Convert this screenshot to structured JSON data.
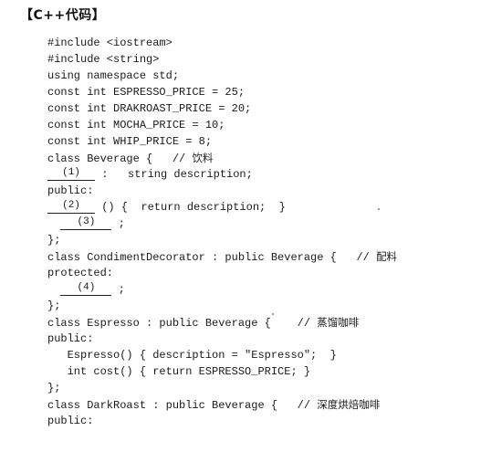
{
  "heading": "【C++代码】",
  "code": {
    "l1": "#include <iostream>",
    "l2": "#include <string>",
    "l3": "using namespace std;",
    "l4": "const int ESPRESSO_PRICE = 25;",
    "l5": "const int DRAKROAST_PRICE = 20;",
    "l6": "const int MOCHA_PRICE = 10;",
    "l7": "const int WHIP_PRICE = 8;",
    "l8_code": "class Beverage {   // ",
    "l8_comment": "饮料",
    "l9_blank": "(1)",
    "l9_rest": " :   string description;",
    "l10": "public:",
    "l11_blank": "(2)",
    "l11_rest": " () {  return description;  }",
    "l12_blank": "(3)",
    "l12_rest": " ;",
    "l13": "};",
    "l14_code": "class CondimentDecorator : public Beverage {   // ",
    "l14_comment": "配料",
    "l15": "protected:",
    "l16_blank": "(4)",
    "l16_rest": " ;",
    "l17": "};",
    "l18_code": "class Espresso : public Beverage {    // ",
    "l18_comment": "蒸馏咖啡",
    "l19": "public:",
    "l20": "   Espresso() { description = \"Espresso\";  }",
    "l21": "   int cost() { return ESPRESSO_PRICE; }",
    "l22": "};",
    "l23_code": "class DarkRoast : public Beverage {   // ",
    "l23_comment": "深度烘焙咖啡",
    "l24": "public:"
  }
}
